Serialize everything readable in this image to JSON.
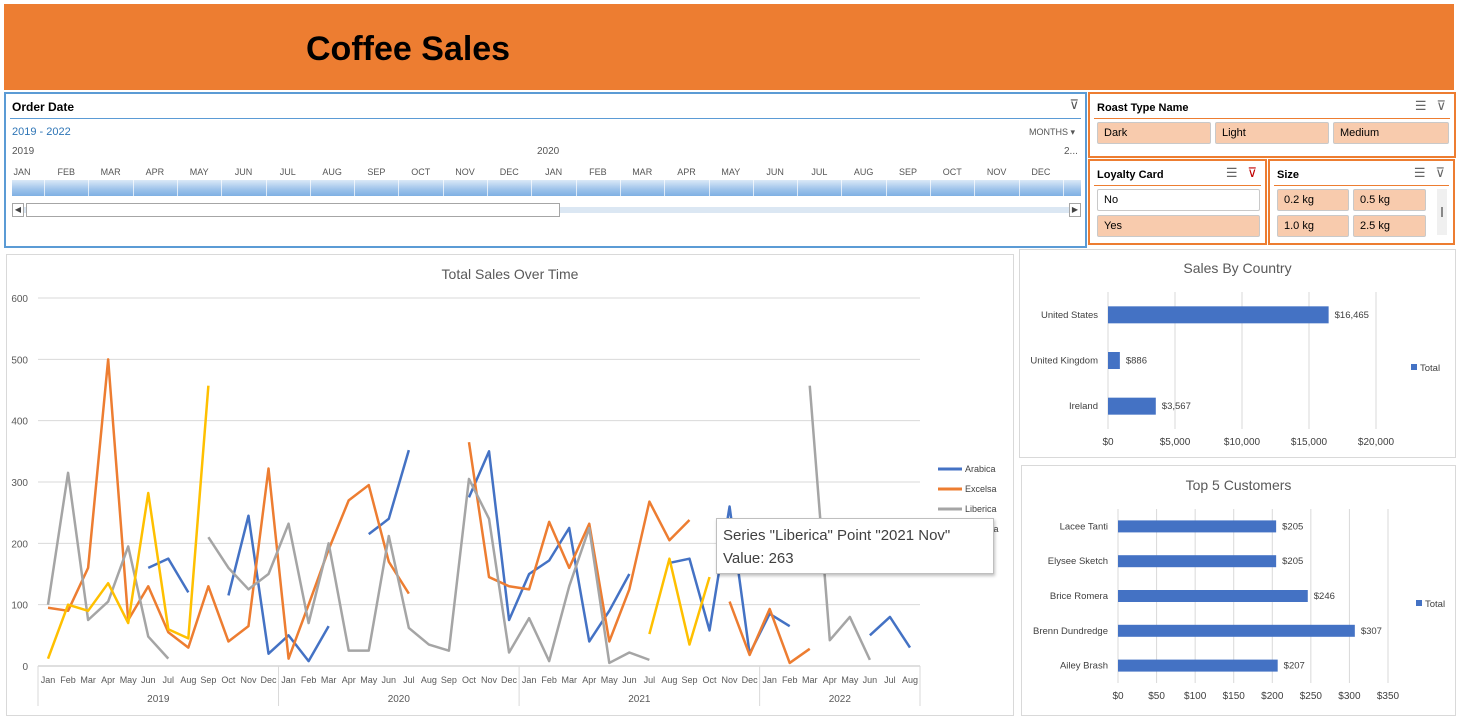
{
  "header": {
    "title": "Coffee Sales"
  },
  "timeline": {
    "title": "Order Date",
    "range": "2019 - 2022",
    "level": "MONTHS",
    "years": [
      "2019",
      "2020",
      "2..."
    ],
    "months": [
      "JAN",
      "FEB",
      "MAR",
      "APR",
      "MAY",
      "JUN",
      "JUL",
      "AUG",
      "SEP",
      "OCT",
      "NOV",
      "DEC",
      "JAN",
      "FEB",
      "MAR",
      "APR",
      "MAY",
      "JUN",
      "JUL",
      "AUG",
      "SEP",
      "OCT",
      "NOV",
      "DEC"
    ]
  },
  "slicers": {
    "roast": {
      "title": "Roast Type Name",
      "items": [
        "Dark",
        "Light",
        "Medium"
      ]
    },
    "loyalty": {
      "title": "Loyalty Card",
      "items": [
        "No",
        "Yes"
      ]
    },
    "size": {
      "title": "Size",
      "items": [
        "0.2 kg",
        "0.5 kg",
        "1.0 kg",
        "2.5 kg"
      ]
    }
  },
  "colors": {
    "banner": "#ed7d31",
    "arabica": "#4472c4",
    "excelsa": "#ed7d31",
    "liberica": "#a5a5a5",
    "robusta": "#ffc000",
    "bar": "#4472c4"
  },
  "chart_data": [
    {
      "type": "line",
      "title": "Total Sales Over Time",
      "ylim": [
        0,
        600
      ],
      "yticks": [
        0,
        100,
        200,
        300,
        400,
        500,
        600
      ],
      "years": [
        "2019",
        "2020",
        "2021",
        "2022"
      ],
      "x": [
        "Jan",
        "Feb",
        "Mar",
        "Apr",
        "May",
        "Jun",
        "Jul",
        "Aug",
        "Sep",
        "Oct",
        "Nov",
        "Dec",
        "Jan",
        "Feb",
        "Mar",
        "Apr",
        "May",
        "Jun",
        "Jul",
        "Aug",
        "Sep",
        "Oct",
        "Nov",
        "Dec",
        "Jan",
        "Feb",
        "Mar",
        "Apr",
        "May",
        "Jun",
        "Jul",
        "Aug",
        "Sep",
        "Oct",
        "Nov",
        "Dec",
        "Jan",
        "Feb",
        "Mar",
        "Apr",
        "May",
        "Jun",
        "Jul",
        "Aug"
      ],
      "legend": "right",
      "series": [
        {
          "name": "Arabica",
          "color": "#4472c4",
          "values": [
            null,
            null,
            null,
            null,
            null,
            160,
            175,
            120,
            null,
            115,
            245,
            20,
            50,
            8,
            65,
            null,
            215,
            240,
            352,
            null,
            null,
            275,
            350,
            75,
            150,
            172,
            225,
            40,
            90,
            150,
            null,
            168,
            175,
            58,
            260,
            20,
            85,
            65,
            null,
            null,
            null,
            50,
            80,
            30
          ]
        },
        {
          "name": "Excelsa",
          "color": "#ed7d31",
          "values": [
            95,
            90,
            160,
            500,
            75,
            130,
            55,
            30,
            130,
            40,
            65,
            322,
            12,
            100,
            190,
            270,
            295,
            170,
            118,
            null,
            null,
            365,
            145,
            130,
            125,
            235,
            160,
            232,
            40,
            125,
            268,
            205,
            238,
            null,
            105,
            18,
            93,
            5,
            28,
            null,
            null,
            null,
            null,
            40
          ]
        },
        {
          "name": "Liberica",
          "color": "#a5a5a5",
          "values": [
            100,
            315,
            75,
            105,
            195,
            48,
            12,
            null,
            210,
            160,
            125,
            150,
            232,
            70,
            200,
            25,
            25,
            212,
            62,
            35,
            25,
            305,
            240,
            22,
            78,
            8,
            130,
            225,
            5,
            22,
            10,
            null,
            null,
            null,
            null,
            null,
            null,
            null,
            457,
            42,
            80,
            10,
            null,
            null
          ]
        },
        {
          "name": "Robusta",
          "color": "#ffc000",
          "values": [
            12,
            100,
            90,
            135,
            70,
            282,
            60,
            45,
            457,
            null,
            null,
            null,
            null,
            null,
            null,
            null,
            null,
            null,
            null,
            null,
            null,
            null,
            null,
            null,
            null,
            null,
            null,
            null,
            null,
            null,
            52,
            175,
            35,
            145,
            null,
            null,
            null,
            null,
            null,
            null,
            null,
            null,
            null,
            null
          ]
        }
      ],
      "tooltip": {
        "line1": "Series \"Liberica\" Point \"2021 Nov\"",
        "line2": "Value: 263"
      }
    },
    {
      "type": "bar",
      "title": "Sales By Country",
      "categories": [
        "United States",
        "United Kingdom",
        "Ireland"
      ],
      "values": [
        16465,
        886,
        3567
      ],
      "labels": [
        "$16,465",
        "$886",
        "$3,567"
      ],
      "xlim": [
        0,
        20000
      ],
      "xticks": [
        "$0",
        "$5,000",
        "$10,000",
        "$15,000",
        "$20,000"
      ],
      "legend": "Total"
    },
    {
      "type": "bar",
      "title": "Top 5 Customers",
      "categories": [
        "Lacee Tanti",
        "Elysee Sketch",
        "Brice Romera",
        "Brenn Dundredge",
        "Ailey Brash"
      ],
      "values": [
        205,
        205,
        246,
        307,
        207
      ],
      "labels": [
        "$205",
        "$205",
        "$246",
        "$307",
        "$207"
      ],
      "xlim": [
        0,
        350
      ],
      "xticks": [
        "$0",
        "$50",
        "$100",
        "$150",
        "$200",
        "$250",
        "$300",
        "$350"
      ],
      "legend": "Total"
    }
  ]
}
